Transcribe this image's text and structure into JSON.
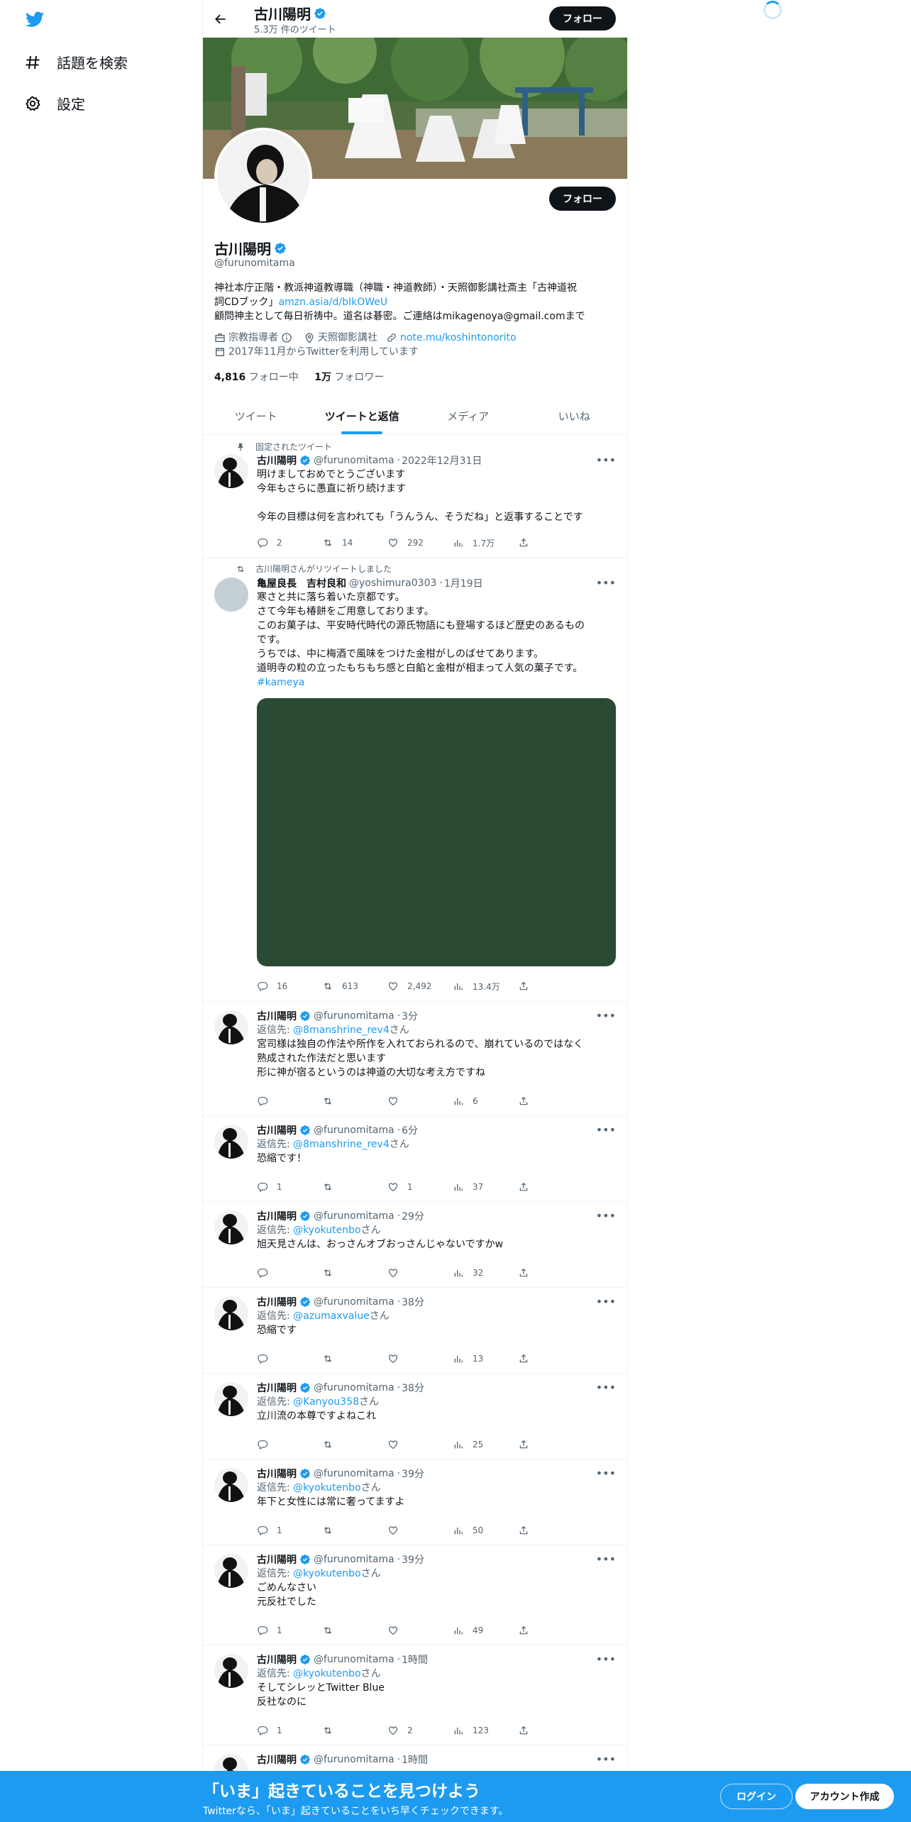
{
  "nav": {
    "logo": "twitter-bird",
    "explore_label": "話題を検索",
    "settings_label": "設定"
  },
  "header": {
    "name": "古川陽明",
    "tweet_count": "5.3万 件のツイート",
    "follow_label": "フォロー"
  },
  "profile": {
    "name": "古川陽明",
    "handle": "@furunomitama",
    "follow_label": "フォロー",
    "bio_line1": "神社本庁正階・教派神道教導職（神職・神道教師）・天照御影講社斎主「古神道祝",
    "bio_line2_text": "詞CDブック」",
    "bio_link": "amzn.asia/d/bIkOWeU",
    "bio_line3": "顧問神主として毎日祈祷中。道名は碁密。ご連絡はmikagenoya@gmail.comまで",
    "category": "宗教指導者",
    "location": "天照御影講社",
    "website": "note.mu/koshintonorito",
    "joined": "2017年11月からTwitterを利用しています",
    "following_count": "4,816",
    "following_label": "フォロー中",
    "followers_count": "1万",
    "followers_label": "フォロワー"
  },
  "tabs": [
    "ツイート",
    "ツイートと返信",
    "メディア",
    "いいね"
  ],
  "pinned_label": "固定されたツイート",
  "retweet_label": "古川陽明さんがリツイートしました",
  "tweets": [
    {
      "name": "古川陽明",
      "handle": "@furunomitama",
      "time": "2022年12月31日",
      "text": "明けましておめでとうございます\n今年もさらに愚直に祈り続けます\n\n今年の目標は何を言われても「うんうん、そうだね」と返事することです",
      "replies": "2",
      "retweets": "14",
      "likes": "292",
      "views": "1.7万"
    },
    {
      "name": "亀屋良長　吉村良和",
      "handle": "@yoshimura0303",
      "time": "1月19日",
      "text": "寒さと共に落ち着いた京都です。\nさて今年も椿餅をご用意しております。\nこのお菓子は、平安時代時代の源氏物語にも登場するほど歴史のあるもの\nです。\nうちでは、中に梅酒で風味をつけた金柑がしのばせてあります。\n道明寺の粒の立ったもちもち感と白餡と金柑が相まって人気の菓子です。",
      "hashtag": "#kameya",
      "media_color": "#2b4a33",
      "replies": "16",
      "retweets": "613",
      "likes": "2,492",
      "views": "13.4万"
    },
    {
      "name": "古川陽明",
      "handle": "@furunomitama",
      "time": "3分",
      "reply_prefix": "返信先: ",
      "reply_to": "@8manshrine_rev4",
      "reply_suffix": "さん",
      "text": "宮司様は独自の作法や所作を入れておられるので、崩れているのではなく\n熟成された作法だと思います\n形に神が宿るというのは神道の大切な考え方ですね",
      "replies": "",
      "retweets": "",
      "likes": "",
      "views": "6"
    },
    {
      "name": "古川陽明",
      "handle": "@furunomitama",
      "time": "6分",
      "reply_prefix": "返信先: ",
      "reply_to": "@8manshrine_rev4",
      "reply_suffix": "さん",
      "text": "恐縮です！",
      "replies": "1",
      "retweets": "",
      "likes": "1",
      "views": "37"
    },
    {
      "name": "古川陽明",
      "handle": "@furunomitama",
      "time": "29分",
      "reply_prefix": "返信先: ",
      "reply_to": "@kyokutenbo",
      "reply_suffix": "さん",
      "text": "旭天見さんは、おっさんオブおっさんじゃないですかw",
      "replies": "",
      "retweets": "",
      "likes": "",
      "views": "32"
    },
    {
      "name": "古川陽明",
      "handle": "@furunomitama",
      "time": "38分",
      "reply_prefix": "返信先: ",
      "reply_to": "@azumaxvalue",
      "reply_suffix": "さん",
      "text": "恐縮です",
      "replies": "",
      "retweets": "",
      "likes": "",
      "views": "13"
    },
    {
      "name": "古川陽明",
      "handle": "@furunomitama",
      "time": "38分",
      "reply_prefix": "返信先: ",
      "reply_to": "@Kanyou358",
      "reply_suffix": "さん",
      "text": "立川流の本尊ですよねこれ",
      "replies": "",
      "retweets": "",
      "likes": "",
      "views": "25"
    },
    {
      "name": "古川陽明",
      "handle": "@furunomitama",
      "time": "39分",
      "reply_prefix": "返信先: ",
      "reply_to": "@kyokutenbo",
      "reply_suffix": "さん",
      "text": "年下と女性には常に奢ってますよ",
      "replies": "1",
      "retweets": "",
      "likes": "",
      "views": "50"
    },
    {
      "name": "古川陽明",
      "handle": "@furunomitama",
      "time": "39分",
      "reply_prefix": "返信先: ",
      "reply_to": "@kyokutenbo",
      "reply_suffix": "さん",
      "text": "ごめんなさい\n元反社でした",
      "replies": "1",
      "retweets": "",
      "likes": "",
      "views": "49"
    },
    {
      "name": "古川陽明",
      "handle": "@furunomitama",
      "time": "1時間",
      "reply_prefix": "返信先: ",
      "reply_to": "@kyokutenbo",
      "reply_suffix": "さん",
      "text": "そしてシレッとTwitter Blue\n反社なのに",
      "replies": "1",
      "retweets": "",
      "likes": "2",
      "views": "123"
    },
    {
      "name": "古川陽明",
      "handle": "@furunomitama",
      "time": "1時間"
    }
  ],
  "bottom": {
    "title": "「いま」起きていることを見つけよう",
    "subtitle": "Twitterなら、「いま」起きていることをいち早くチェックできます。",
    "login_label": "ログイン",
    "signup_label": "アカウント作成"
  },
  "colors": {
    "accent": "#1d9bf0",
    "text": "#0f1419",
    "muted": "#536471",
    "bottom_bar": "#1d9bf0"
  }
}
